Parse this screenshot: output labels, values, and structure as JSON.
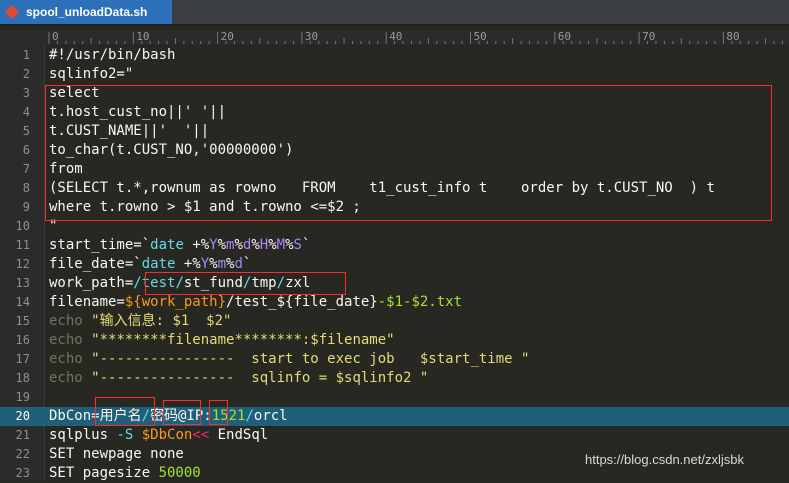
{
  "tab": {
    "filename": "spool_unloadData.sh",
    "icon": "file-modified-icon"
  },
  "ruler": {
    "labels": [
      "0",
      "10",
      "20",
      "30",
      "40",
      "50",
      "60",
      "70",
      "80"
    ]
  },
  "editor": {
    "lines": [
      {
        "n": "1",
        "t": [
          [
            "#!/usr/bin/bash",
            "w"
          ]
        ]
      },
      {
        "n": "2",
        "t": [
          [
            "sqlinfo2=\"",
            "w"
          ]
        ]
      },
      {
        "n": "3",
        "t": [
          [
            "select",
            "w"
          ]
        ]
      },
      {
        "n": "4",
        "t": [
          [
            "t.host_cust_no||' '||",
            "w"
          ]
        ]
      },
      {
        "n": "5",
        "t": [
          [
            "t.CUST_NAME||'  '||",
            "w"
          ]
        ]
      },
      {
        "n": "6",
        "t": [
          [
            "to_char(t.CUST_NO,'00000000')",
            "w"
          ]
        ]
      },
      {
        "n": "7",
        "t": [
          [
            "from",
            "w"
          ]
        ]
      },
      {
        "n": "8",
        "t": [
          [
            "(SELECT t.*,rownum as rowno   FROM    t1_cust_info t    order by t.CUST_NO  ) t",
            "w"
          ]
        ]
      },
      {
        "n": "9",
        "t": [
          [
            "where t.rowno > $1 and t.rowno <=$2 ;",
            "w"
          ]
        ]
      },
      {
        "n": "10",
        "t": [
          [
            "\"",
            "w"
          ]
        ]
      },
      {
        "n": "11",
        "t": [
          [
            "start_time=`",
            "w"
          ],
          [
            "date ",
            "k"
          ],
          [
            "+%",
            "w"
          ],
          [
            "Y",
            "n"
          ],
          [
            "%",
            "w"
          ],
          [
            "m",
            "n"
          ],
          [
            "%",
            "w"
          ],
          [
            "d",
            "n"
          ],
          [
            "%",
            "w"
          ],
          [
            "H",
            "n"
          ],
          [
            "%",
            "w"
          ],
          [
            "M",
            "n"
          ],
          [
            "%",
            "w"
          ],
          [
            "S",
            "n"
          ],
          [
            "`",
            "w"
          ]
        ]
      },
      {
        "n": "12",
        "t": [
          [
            "file_date=`",
            "w"
          ],
          [
            "date ",
            "k"
          ],
          [
            "+%",
            "w"
          ],
          [
            "Y",
            "n"
          ],
          [
            "%",
            "w"
          ],
          [
            "m",
            "n"
          ],
          [
            "%",
            "w"
          ],
          [
            "d",
            "n"
          ],
          [
            "`",
            "w"
          ]
        ]
      },
      {
        "n": "13",
        "t": [
          [
            "work_path=",
            "w"
          ],
          [
            "/test/",
            "k"
          ],
          [
            "st_fund",
            "w"
          ],
          [
            "/",
            "k"
          ],
          [
            "tmp",
            "w"
          ],
          [
            "/",
            "k"
          ],
          [
            "zxl",
            "w"
          ]
        ]
      },
      {
        "n": "14",
        "t": [
          [
            "filename=",
            "w"
          ],
          [
            "${work_path}",
            "v"
          ],
          [
            "/test_${file_date}",
            "w"
          ],
          [
            "-$1-$2.txt",
            "g"
          ]
        ]
      },
      {
        "n": "15",
        "t": [
          [
            "echo ",
            "e"
          ],
          [
            "\"输入信息: $1  $2\"",
            "s"
          ]
        ]
      },
      {
        "n": "16",
        "t": [
          [
            "echo ",
            "e"
          ],
          [
            "\"********filename********:$filename\"",
            "s"
          ]
        ]
      },
      {
        "n": "17",
        "t": [
          [
            "echo ",
            "e"
          ],
          [
            "\"----------------  start to exec job   $start_time \"",
            "s"
          ]
        ]
      },
      {
        "n": "18",
        "t": [
          [
            "echo ",
            "e"
          ],
          [
            "\"----------------  sqlinfo = $sqlinfo2 \"",
            "s"
          ]
        ]
      },
      {
        "n": "19",
        "t": [
          [
            "",
            "w"
          ]
        ]
      },
      {
        "n": "20",
        "t": [
          [
            "DbCon=用户名",
            "w"
          ],
          [
            "/",
            "k"
          ],
          [
            "密码",
            "w"
          ],
          [
            "@IP:",
            "w"
          ],
          [
            "1521",
            "g"
          ],
          [
            "/",
            "k"
          ],
          [
            "orcl",
            "w"
          ]
        ],
        "active": true
      },
      {
        "n": "21",
        "t": [
          [
            "sqlplus ",
            "w"
          ],
          [
            "-S ",
            "k"
          ],
          [
            "$DbCon",
            "v"
          ],
          [
            "<< ",
            "p"
          ],
          [
            "EndSql",
            "w"
          ]
        ]
      },
      {
        "n": "22",
        "t": [
          [
            "SET newpage none",
            "w"
          ]
        ]
      },
      {
        "n": "23",
        "t": [
          [
            "SET pagesize ",
            "w"
          ],
          [
            "50000",
            "g"
          ]
        ]
      }
    ]
  },
  "watermark": "https://blog.csdn.net/zxljsbk",
  "colors": {
    "background": "#272822",
    "active_line": "#1f5f7a",
    "highlight_box": "#ff2b2b"
  }
}
